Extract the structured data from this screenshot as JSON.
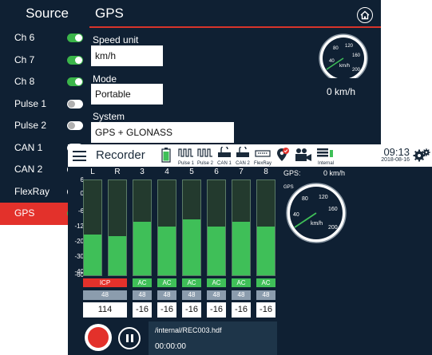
{
  "back_window": {
    "source_title": "Source",
    "gps_title": "GPS",
    "sources": [
      {
        "label": "Ch 6",
        "toggle": "on"
      },
      {
        "label": "Ch 7",
        "toggle": "on"
      },
      {
        "label": "Ch 8",
        "toggle": "on"
      },
      {
        "label": "Pulse 1",
        "toggle": "off"
      },
      {
        "label": "Pulse 2",
        "toggle": "off"
      },
      {
        "label": "CAN 1",
        "toggle": "off"
      },
      {
        "label": "CAN 2",
        "toggle": "off"
      },
      {
        "label": "FlexRay",
        "toggle": "off"
      },
      {
        "label": "GPS",
        "toggle": "on",
        "selected": true
      }
    ],
    "speed_unit_label": "Speed unit",
    "speed_unit_value": "km/h",
    "mode_label": "Mode",
    "mode_value": "Portable",
    "system_label": "System",
    "system_value": "GPS + GLONASS",
    "speed_readout": "0 km/h",
    "gauge_ticks": [
      "40",
      "80",
      "120",
      "160",
      "200"
    ],
    "gauge_unit": "km/h"
  },
  "recorder": {
    "title": "Recorder",
    "header_icons": [
      {
        "name": "battery-icon",
        "caption": ""
      },
      {
        "name": "pulse-1-icon",
        "caption": "Pulse 1"
      },
      {
        "name": "pulse-2-icon",
        "caption": "Pulse 2"
      },
      {
        "name": "can-1-icon",
        "caption": "CAN 1"
      },
      {
        "name": "can-2-icon",
        "caption": "CAN 2"
      },
      {
        "name": "flexray-icon",
        "caption": "FlexRay"
      },
      {
        "name": "gps-pin-icon",
        "caption": ""
      },
      {
        "name": "camera-icon",
        "caption": ""
      },
      {
        "name": "storage-icon",
        "caption": "Internal"
      }
    ],
    "time": "09:13",
    "date": "2018-08-16",
    "scale": [
      "6",
      "0",
      "-6",
      "-12",
      "-20",
      "-30",
      "-40",
      "-60"
    ],
    "channels": [
      {
        "label": "L",
        "level": 0.43,
        "mode": "ICP",
        "rate": "48",
        "value": "114"
      },
      {
        "label": "R",
        "level": 0.41,
        "mode": "",
        "rate": "",
        "value": ""
      },
      {
        "label": "3",
        "level": 0.56,
        "mode": "AC",
        "rate": "48",
        "value": "-16"
      },
      {
        "label": "4",
        "level": 0.51,
        "mode": "AC",
        "rate": "48",
        "value": "-16"
      },
      {
        "label": "5",
        "level": 0.59,
        "mode": "AC",
        "rate": "48",
        "value": "-16"
      },
      {
        "label": "6",
        "level": 0.51,
        "mode": "AC",
        "rate": "48",
        "value": "-16"
      },
      {
        "label": "7",
        "level": 0.56,
        "mode": "AC",
        "rate": "48",
        "value": "-16"
      },
      {
        "label": "8",
        "level": 0.51,
        "mode": "AC",
        "rate": "48",
        "value": "-16"
      }
    ],
    "gps_label": "GPS:",
    "gps_value": "0  km/h",
    "gauge_label": "GPS",
    "gauge_ticks": [
      "40",
      "80",
      "120",
      "160",
      "200"
    ],
    "gauge_unit": "km/h",
    "file_path": "/internal/REC003.hdf",
    "elapsed": "00:00:00"
  },
  "colors": {
    "background": "#0f2033",
    "accent_red": "#e3312b",
    "meter_green": "#3fbf58",
    "toggle_green": "#3bb54a"
  }
}
